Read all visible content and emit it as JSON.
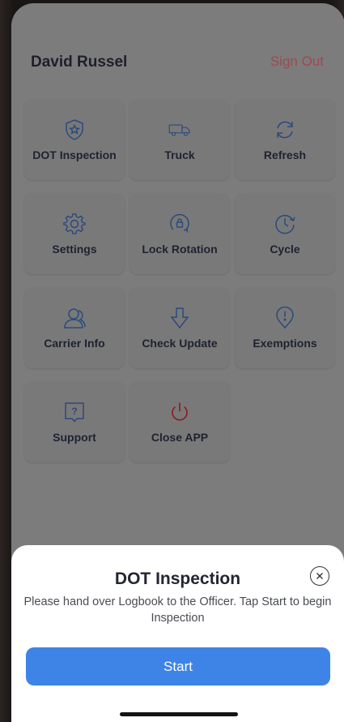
{
  "header": {
    "user_name": "David Russel",
    "sign_out_label": "Sign Out"
  },
  "menu": {
    "items": [
      {
        "label": "DOT Inspection",
        "icon": "shield-star-icon"
      },
      {
        "label": "Truck",
        "icon": "truck-icon"
      },
      {
        "label": "Refresh",
        "icon": "refresh-icon"
      },
      {
        "label": "Settings",
        "icon": "gear-icon"
      },
      {
        "label": "Lock Rotation",
        "icon": "lock-rotation-icon"
      },
      {
        "label": "Cycle",
        "icon": "clock-cycle-icon"
      },
      {
        "label": "Carrier Info",
        "icon": "person-icon"
      },
      {
        "label": "Check Update",
        "icon": "arrow-down-icon"
      },
      {
        "label": "Exemptions",
        "icon": "alert-pin-icon"
      },
      {
        "label": "Support",
        "icon": "help-message-icon"
      },
      {
        "label": "Close APP",
        "icon": "power-icon"
      }
    ]
  },
  "dialog": {
    "title": "DOT Inspection",
    "message": "Please hand over Logbook to the Officer. Tap Start to begin Inspection",
    "start_label": "Start"
  },
  "colors": {
    "accent": "#3d84e6",
    "sign_out": "#9d4a4e",
    "close_app_icon": "#8a2020",
    "icon_blue": "#2a4a7a"
  }
}
